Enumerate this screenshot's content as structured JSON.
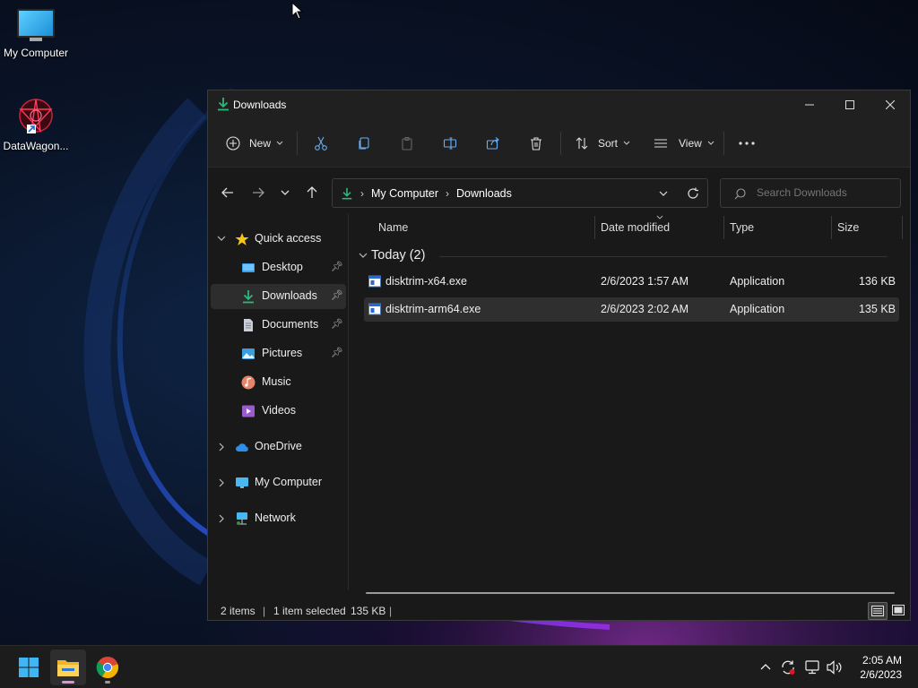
{
  "desktop": {
    "icons": [
      {
        "label": "My Computer"
      },
      {
        "label": "DataWagon..."
      }
    ]
  },
  "window": {
    "title": "Downloads",
    "toolbar": {
      "new_label": "New",
      "sort_label": "Sort",
      "view_label": "View"
    },
    "address": {
      "crumbs": [
        "My Computer",
        "Downloads"
      ],
      "search_placeholder": "Search Downloads"
    },
    "sidebar": {
      "quick_access": "Quick access",
      "items": [
        {
          "label": "Desktop",
          "pinned": true
        },
        {
          "label": "Downloads",
          "pinned": true
        },
        {
          "label": "Documents",
          "pinned": true
        },
        {
          "label": "Pictures",
          "pinned": true
        },
        {
          "label": "Music",
          "pinned": false
        },
        {
          "label": "Videos",
          "pinned": false
        }
      ],
      "onedrive": "OneDrive",
      "mycomputer": "My Computer",
      "network": "Network"
    },
    "columns": {
      "name": "Name",
      "date": "Date modified",
      "type": "Type",
      "size": "Size"
    },
    "group_label": "Today (2)",
    "files": [
      {
        "name": "disktrim-x64.exe",
        "date": "2/6/2023 1:57 AM",
        "type": "Application",
        "size": "136 KB"
      },
      {
        "name": "disktrim-arm64.exe",
        "date": "2/6/2023 2:02 AM",
        "type": "Application",
        "size": "135 KB"
      }
    ],
    "status": {
      "items": "2 items",
      "selected": "1 item selected",
      "selected_size": "135 KB"
    }
  },
  "taskbar": {
    "time": "2:05 AM",
    "date": "2/6/2023"
  },
  "colors": {
    "accent": "#4cc2ff",
    "download_green": "#2fb67a",
    "window_bg": "#191919"
  }
}
